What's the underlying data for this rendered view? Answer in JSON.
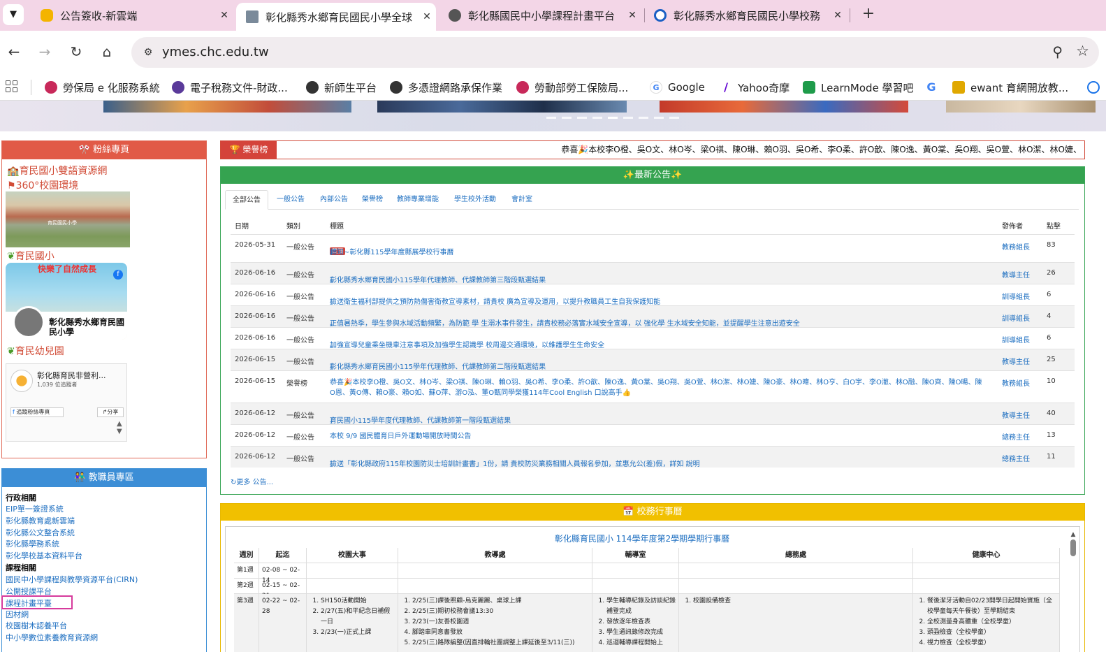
{
  "tabs": [
    {
      "title": "公告簽收-新雲端",
      "favicon_color": "#f4b400",
      "icon": "cloud-icon"
    },
    {
      "title": "彰化縣秀水鄉育民國民小學全球",
      "favicon_color": "#7a8a9a",
      "icon": "school-icon"
    },
    {
      "title": "彰化縣國民中小學課程計畫平台",
      "favicon_color": "#555555",
      "icon": "globe-icon"
    },
    {
      "title": "彰化縣秀水鄉育民國民小學校務",
      "favicon_color": "#1a5fc4",
      "icon": "chrome-icon"
    }
  ],
  "url": "ymes.chc.edu.tw",
  "bookmarks": [
    {
      "label": "勞保局 e 化服務系統",
      "color": "#c8295a"
    },
    {
      "label": "電子稅務文件-財政...",
      "color": "#5a3a9a"
    },
    {
      "label": "新師生平台",
      "color": "#333333"
    },
    {
      "label": "多憑證網路承保作業",
      "color": "#333333"
    },
    {
      "label": "勞動部勞工保險局...",
      "color": "#c8295a"
    },
    {
      "label": "Google",
      "color": "#4285f4"
    },
    {
      "label": "Yahoo奇摩",
      "color": "#6001d2"
    },
    {
      "label": "LearnMode 學習吧",
      "color": "#1e9b4a"
    },
    {
      "label": "",
      "color": "#4285f4"
    },
    {
      "label": "ewant 育網開放教...",
      "color": "#e0a800"
    }
  ],
  "fan_panel": {
    "title": "粉絲專頁",
    "link_bilingual": "育民國小雙語資源網",
    "link_360": "360°校園環境",
    "school_photo_label": "育民國民小學",
    "label_school": "育民國小",
    "fb_card_headline": "快樂了自然成長",
    "fb_card_name": "彰化縣秀水鄉育民國民小學",
    "label_kindergarten": "育民幼兒園",
    "embed_name": "彰化縣育民非營利...",
    "embed_followers": "1,039 位追蹤者",
    "embed_follow_btn": "追蹤粉絲專頁",
    "embed_share_btn": "分享"
  },
  "staff_panel": {
    "title": "教職員專區",
    "section_admin": "行政相關",
    "admin_links": [
      "EIP單一簽證系統",
      "彰化縣教育處新雲端",
      "彰化縣公文整合系統",
      "彰化縣學務系統",
      "彰化學校基本資料平台"
    ],
    "section_course": "課程相關",
    "course_links": [
      "國民中小學課程與教學資源平台(CIRN)",
      "公開授課平台",
      "課程計畫平臺",
      "因材網",
      "校園樹木認養平台",
      "中小學數位素養教育資源網"
    ]
  },
  "honor": {
    "tag": "榮譽榜",
    "text": "恭喜🎉本校李O橙、吳O文、林O岑、梁O祺、陳O琳、賴O羽、吳O希、李O柔、許O歆、陳O逸、黃O棠、吳O翔、吳O萱、林O潔、林O婕、"
  },
  "news": {
    "title": "✨最新公告✨",
    "tabs": [
      "全部公告",
      "一般公告",
      "內部公告",
      "榮譽榜",
      "教師專業增能",
      "學生校外活動",
      "會計室"
    ],
    "headers": {
      "date": "日期",
      "type": "類別",
      "title": "標題",
      "poster": "發佈者",
      "clicks": "點擊"
    },
    "rows": [
      {
        "date": "2026-05-31",
        "type": "一般公告",
        "badge": "置頂",
        "title": "轉知~彰化縣115學年度縣展學校行事曆",
        "poster": "教務組長",
        "clicks": "83"
      },
      {
        "date": "2026-06-16",
        "type": "一般公告",
        "badge": "",
        "title": "彰化縣秀水鄉育民國小115學年代理教師、代課教師第三階段甄選結果",
        "poster": "教導主任",
        "clicks": "26"
      },
      {
        "date": "2026-06-16",
        "type": "一般公告",
        "badge": "",
        "title": "檢送衛生福利部提供之預防熱傷害衛教宣導素材，請貴校 廣為宣導及運用，以提升教職員工生自我保護知能",
        "poster": "訓導組長",
        "clicks": "6"
      },
      {
        "date": "2026-06-16",
        "type": "一般公告",
        "badge": "",
        "title": "正值暑熱季，學生參與水域活動頻繁，為防範 學 生溺水事件發生，請貴校務必落實水域安全宣導，以 強化學 生水域安全知能，並提醒學生注意出遊安全",
        "poster": "訓導組長",
        "clicks": "4"
      },
      {
        "date": "2026-06-16",
        "type": "一般公告",
        "badge": "",
        "title": "加強宣導兒童乘坐機車注意事項及加強學生認識學 校周邊交通環境，以維護學生生命安全",
        "poster": "訓導組長",
        "clicks": "6"
      },
      {
        "date": "2026-06-15",
        "type": "一般公告",
        "badge": "",
        "title": "彰化縣秀水鄉育民國小115學年代理教師、代課教師第二階段甄選結果",
        "poster": "教導主任",
        "clicks": "25"
      },
      {
        "date": "2026-06-15",
        "type": "榮譽榜",
        "badge": "",
        "title": "恭喜🎉本校李O橙、吳O文、林O岑、梁O祺、陳O琳、賴O羽、吳O希、李O柔、許O歆、陳O逸、黃O棠、吳O翔、吳O萱、林O潔、林O婕、陳O豪、林O暐、林O亨、白O宇、李O澈、林O融、陳O齊、陳O暘、陳O恩、黃O傳、賴O豪、賴O如、蘇O萍、游O泓、董O甄同學榮獲114年Cool English 口說高手👍",
        "poster": "教務組長",
        "clicks": "10"
      },
      {
        "date": "2026-06-12",
        "type": "一般公告",
        "badge": "",
        "title": "育民國小115學年度代理教師、代課教師第一階段甄選結果",
        "poster": "教導主任",
        "clicks": "40"
      },
      {
        "date": "2026-06-12",
        "type": "一般公告",
        "badge": "",
        "title": "本校 9/9 國民體育日戶外運動場開放時間公告",
        "poster": "總務主任",
        "clicks": "13"
      },
      {
        "date": "2026-06-12",
        "type": "一般公告",
        "badge": "",
        "title": "檢送「彰化縣政府115年校園防災士培訓計畫書」1份，請 貴校防災業務相關人員報名參加，並惠允公(差)假，詳如 說明",
        "poster": "總務主任",
        "clicks": "11"
      }
    ],
    "more": "更多 公告..."
  },
  "calendar": {
    "title": "校務行事曆",
    "table_title": "彰化縣育民國小 114學年度第2學期學期行事曆",
    "headers": [
      "週別",
      "起迄",
      "校園大事",
      "教導處",
      "輔導室",
      "總務處",
      "健康中心"
    ],
    "rows": [
      {
        "week": "第1週",
        "range": "02-08 ~ 02-14",
        "campus": [],
        "teach": [],
        "guide": [],
        "general": [],
        "health": []
      },
      {
        "week": "第2週",
        "range": "02-15 ~ 02-21",
        "campus": [],
        "teach": [],
        "guide": [],
        "general": [],
        "health": []
      },
      {
        "week": "第3週",
        "range": "02-22 ~ 02-28",
        "campus": [
          "SH150活動開始",
          "2/27(五)和平紀念日補假一日",
          "2/23(一)正式上課"
        ],
        "teach": [
          "2/25(三)課後照顧-烏克麗麗、桌球上課",
          "2/25(三)期初校務會議13:30",
          "2/23(一)友善校園週",
          "腳踏車同意書發放",
          "2/25(三)路隊編整(因直排輪社團調整上課延後至3/11(三))"
        ],
        "guide": [
          "學生輔導紀錄及訪談紀錄補登完成",
          "發放逐年檢查表",
          "學生通訊錄修改完成",
          "巡迴輔導課程開始上"
        ],
        "general": [
          "校園設備檢查"
        ],
        "health": [
          "餐後潔牙活動自02/23開學日起開始實施（全校學童每天午餐後）至學期結束",
          "全校測量身高體重（全校學童）",
          "頭蝨檢查（全校學童）",
          "視力檢查（全校學童）"
        ]
      }
    ]
  }
}
